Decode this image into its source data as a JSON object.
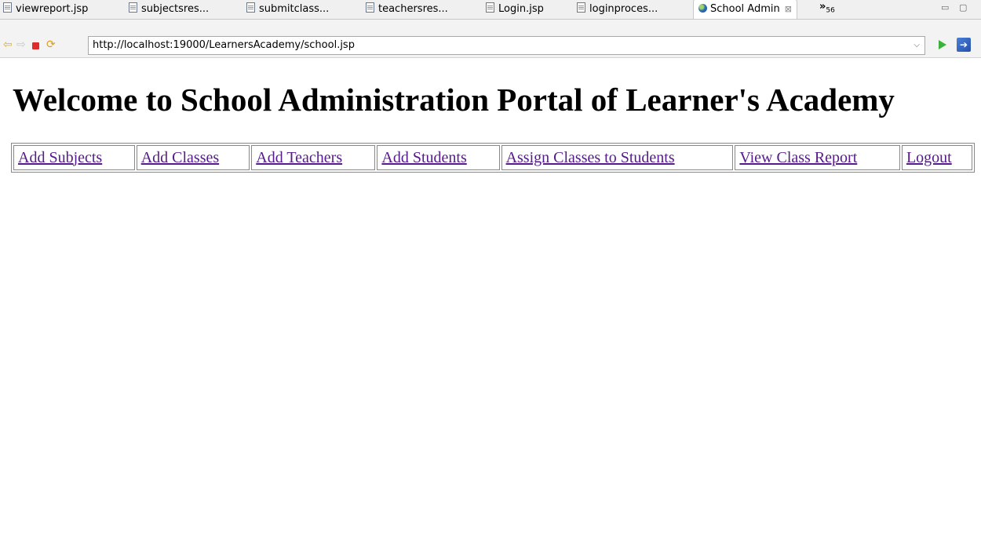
{
  "tabs": [
    {
      "label": "viewreport.jsp",
      "active": false
    },
    {
      "label": "subjectsres...",
      "active": false
    },
    {
      "label": "submitclass...",
      "active": false
    },
    {
      "label": "teachersres...",
      "active": false
    },
    {
      "label": "Login.jsp",
      "active": false
    },
    {
      "label": "loginproces...",
      "active": false
    },
    {
      "label": "School Admin",
      "active": true
    }
  ],
  "tab_close_glyph": "⊠",
  "overflow": {
    "glyph": "»",
    "count": "56"
  },
  "window_controls": {
    "minimize": "▭",
    "maximize": "▢"
  },
  "address_bar": {
    "url": "http://localhost:19000/LearnersAcademy/school.jsp",
    "dropdown_glyph": "⌵"
  },
  "icons": {
    "back": "back-arrow-icon",
    "forward": "forward-arrow-icon",
    "stop": "stop-icon",
    "refresh": "refresh-icon",
    "go": "go-play-icon",
    "external": "open-external-icon"
  },
  "colors": {
    "visited_link": "#551a8b",
    "stop": "#e02b2b",
    "go": "#3bb23b"
  },
  "page": {
    "title": "Welcome to School Administration Portal of Learner's Academy",
    "menu": [
      "Add Subjects",
      "Add Classes",
      "Add Teachers",
      "Add Students",
      "Assign Classes to Students",
      "View Class Report",
      "Logout"
    ]
  }
}
